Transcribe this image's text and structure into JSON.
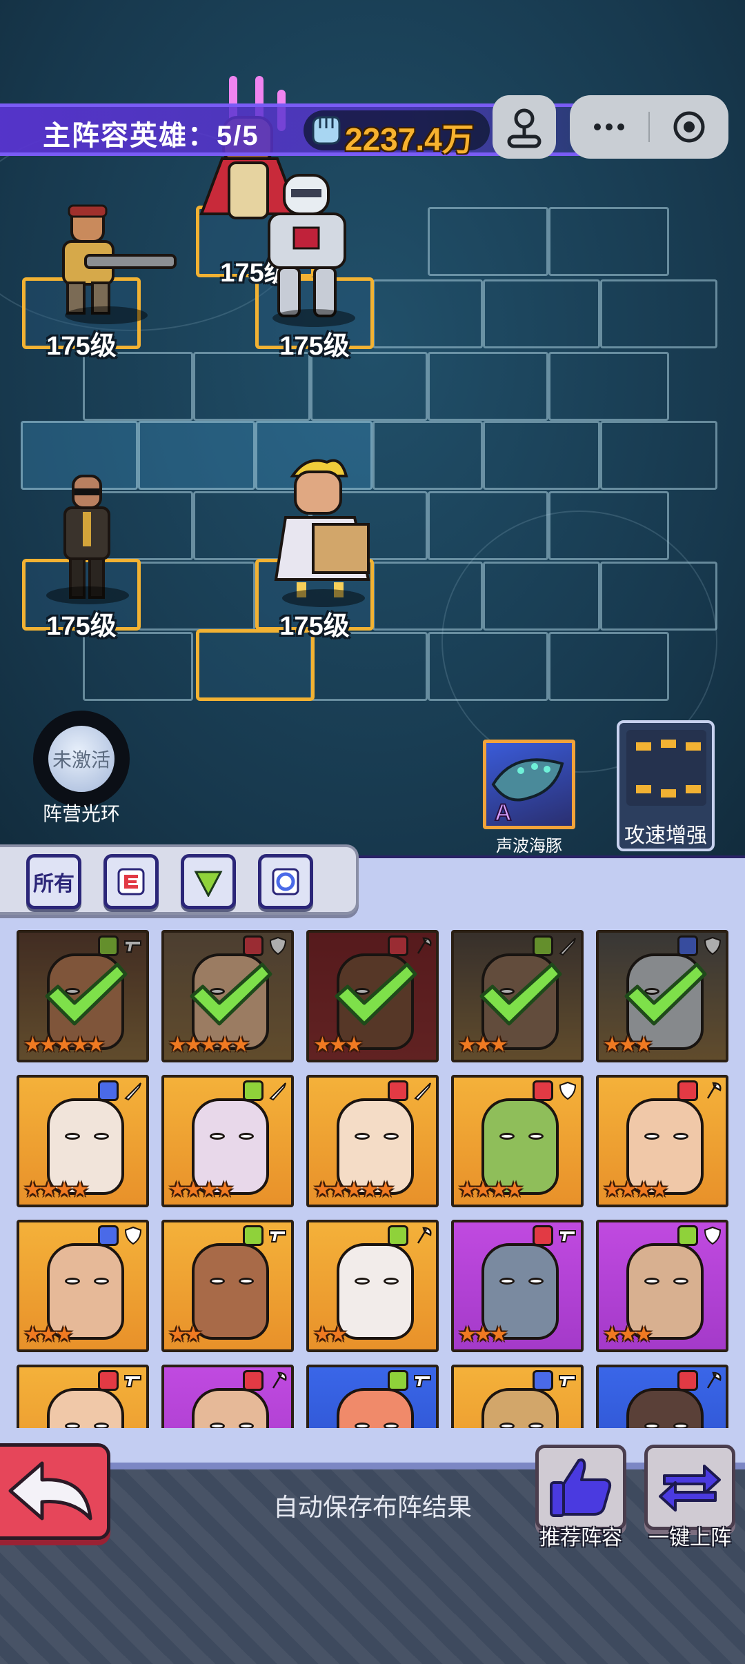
{
  "header": {
    "team_title": "主阵容英雄：",
    "team_count": "5/5",
    "power": "2237.4万",
    "power_icon": "fist-icon",
    "capsule": {
      "more_icon": "more-dots-icon",
      "close_icon": "target-icon",
      "joystick_icon": "joystick-icon"
    }
  },
  "field": {
    "heroes": [
      {
        "id": "commando",
        "level": "175级"
      },
      {
        "id": "king",
        "level": "175级"
      },
      {
        "id": "mech",
        "level": "175级"
      },
      {
        "id": "agent",
        "level": "175级"
      },
      {
        "id": "merchant",
        "level": "175级"
      }
    ]
  },
  "aura": {
    "state": "未激活",
    "label": "阵营光环"
  },
  "pet": {
    "badge": "A",
    "label": "声波海豚"
  },
  "skill": {
    "label": "攻速增强"
  },
  "filters": [
    {
      "label": "所有",
      "icon": ""
    },
    {
      "label": "",
      "icon": "red-faction-icon"
    },
    {
      "label": "",
      "icon": "green-faction-icon"
    },
    {
      "label": "",
      "icon": "blue-faction-icon"
    }
  ],
  "roster": [
    {
      "stars": "★★★★★",
      "frame": "#8a6a3a",
      "bg": "#5a3a2a",
      "faction": "green",
      "weapon": "gun",
      "selected": true
    },
    {
      "stars": "★★★★★",
      "frame": "#8a6a3a",
      "bg": "#6a5540",
      "faction": "red",
      "weapon": "shield",
      "selected": true
    },
    {
      "stars": "★★★",
      "frame": "#8a2a2a",
      "bg": "#7a1e22",
      "faction": "red",
      "weapon": "axe",
      "selected": true
    },
    {
      "stars": "★★★",
      "frame": "#8a6a3a",
      "bg": "#4a3f38",
      "faction": "green",
      "weapon": "sword",
      "selected": true
    },
    {
      "stars": "★★★",
      "frame": "#8a6a3a",
      "bg": "#4c4a48",
      "faction": "blue",
      "weapon": "shield",
      "selected": true
    },
    {
      "stars": "★★★★",
      "frame": "#e8912a",
      "bg": "#f4b13a",
      "faction": "blue",
      "weapon": "sword",
      "selected": false
    },
    {
      "stars": "★★★★",
      "frame": "#e8912a",
      "bg": "#f4b13a",
      "faction": "green",
      "weapon": "sword",
      "selected": false
    },
    {
      "stars": "★★★★★",
      "frame": "#e8912a",
      "bg": "#f4b13a",
      "faction": "red",
      "weapon": "sword",
      "selected": false
    },
    {
      "stars": "★★★★",
      "frame": "#e8912a",
      "bg": "#f4b13a",
      "faction": "red",
      "weapon": "shield",
      "selected": false
    },
    {
      "stars": "★★★★",
      "frame": "#e8912a",
      "bg": "#f4b13a",
      "faction": "red",
      "weapon": "axe",
      "selected": false
    },
    {
      "stars": "★★★",
      "frame": "#e8912a",
      "bg": "#f4b13a",
      "faction": "blue",
      "weapon": "shield",
      "selected": false
    },
    {
      "stars": "★★",
      "frame": "#e8912a",
      "bg": "#f4b13a",
      "faction": "green",
      "weapon": "gun",
      "selected": false
    },
    {
      "stars": "★★",
      "frame": "#e8912a",
      "bg": "#f4b13a",
      "faction": "green",
      "weapon": "axe",
      "selected": false
    },
    {
      "stars": "★★★",
      "frame": "#a43ac9",
      "bg": "#c04ae0",
      "faction": "red",
      "weapon": "gun",
      "selected": false
    },
    {
      "stars": "★★★",
      "frame": "#a43ac9",
      "bg": "#c04ae0",
      "faction": "green",
      "weapon": "shield",
      "selected": false
    },
    {
      "stars": "",
      "frame": "#e8912a",
      "bg": "#f4b13a",
      "faction": "red",
      "weapon": "gun",
      "selected": false
    },
    {
      "stars": "",
      "frame": "#a43ac9",
      "bg": "#c04ae0",
      "faction": "red",
      "weapon": "axe",
      "selected": false
    },
    {
      "stars": "",
      "frame": "#2a4ec9",
      "bg": "#3a66e8",
      "faction": "green",
      "weapon": "gun",
      "selected": false
    },
    {
      "stars": "",
      "frame": "#e8912a",
      "bg": "#f4b13a",
      "faction": "blue",
      "weapon": "gun",
      "selected": false
    },
    {
      "stars": "",
      "frame": "#2a4ec9",
      "bg": "#3a66e8",
      "faction": "red",
      "weapon": "axe",
      "selected": false
    }
  ],
  "bottom": {
    "autosave": "自动保存布阵结果",
    "recommend_label": "推荐阵容",
    "deploy_label": "一键上阵",
    "back_icon": "back-arrow-icon",
    "recommend_icon": "thumbs-up-icon",
    "deploy_icon": "swap-arrows-icon"
  },
  "colors": {
    "accent_purple": "#5834d0",
    "slot_gold": "#f2b233",
    "power_gold": "#f7b22f",
    "back_red": "#e6465a",
    "faction_red": "#e23a44",
    "faction_green": "#8fd23a",
    "faction_blue": "#4a6ae8"
  }
}
